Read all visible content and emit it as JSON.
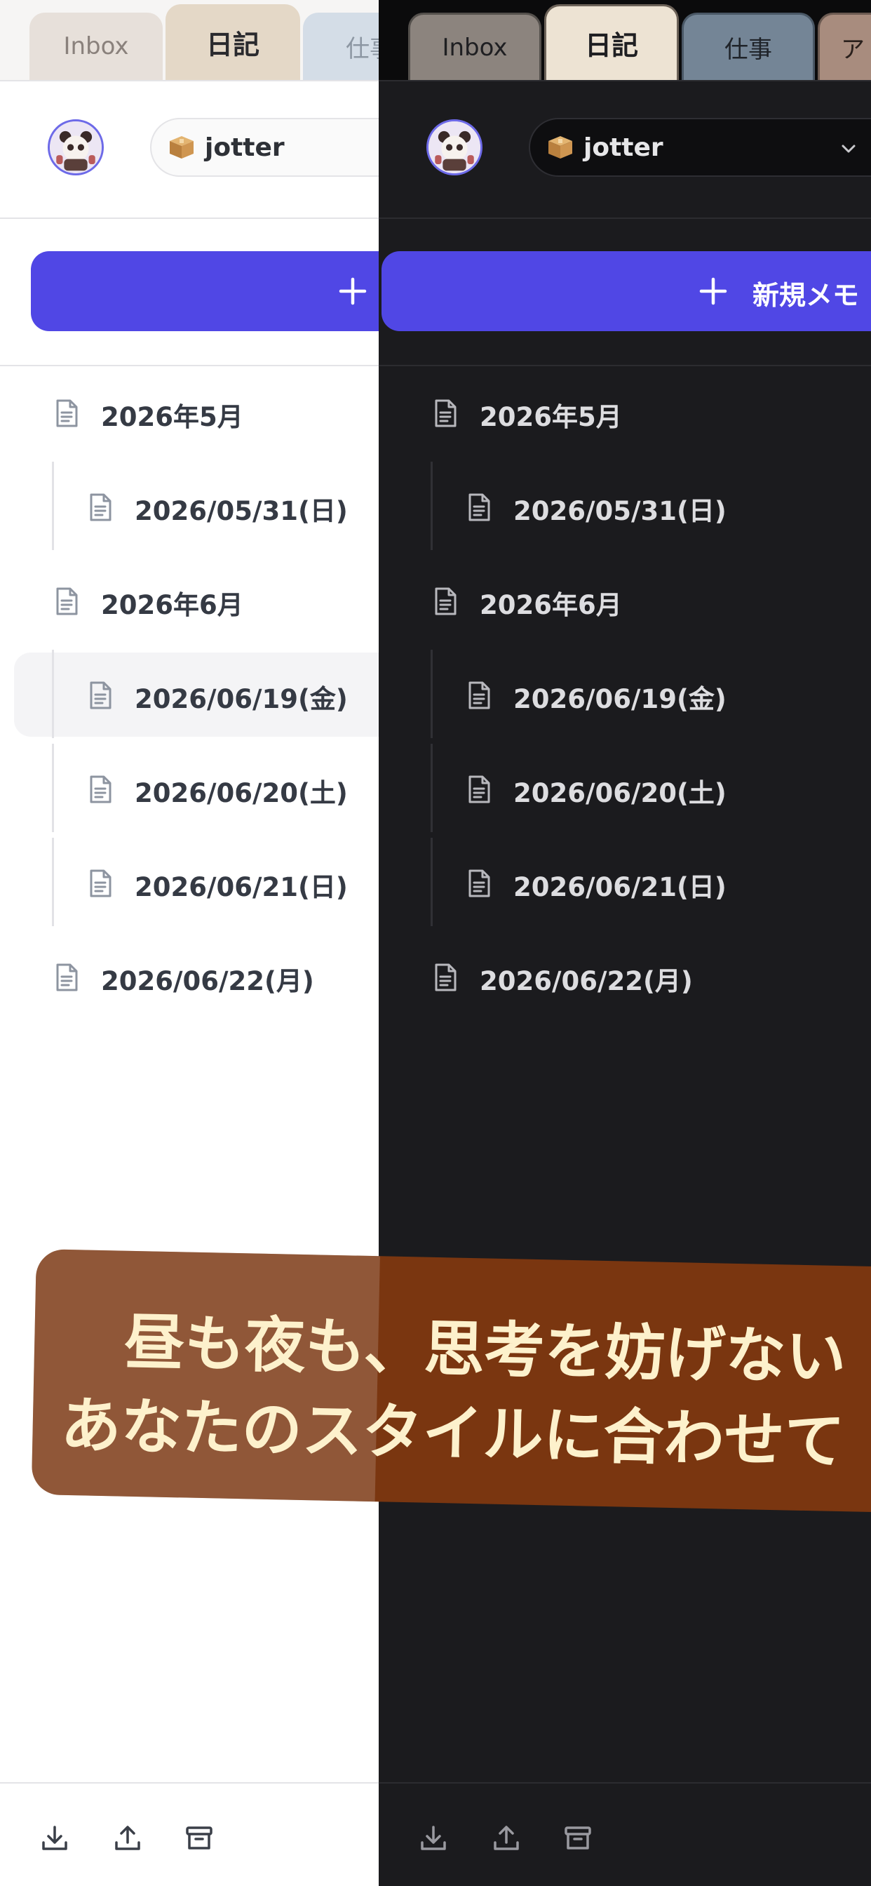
{
  "tabs": [
    "Inbox",
    "日記",
    "仕事",
    "ア"
  ],
  "active_tab": "日記",
  "notebook": {
    "label": "jotter",
    "icon": "package-icon"
  },
  "new_memo": {
    "label": "新規メモ"
  },
  "tree": [
    {
      "label": "2026年5月",
      "level": 0
    },
    {
      "label": "2026/05/31(日)",
      "level": 1
    },
    {
      "label": "2026年6月",
      "level": 0
    },
    {
      "label": "2026/06/19(金)",
      "level": 1,
      "selected_light": true
    },
    {
      "label": "2026/06/20(土)",
      "level": 1
    },
    {
      "label": "2026/06/21(日)",
      "level": 1
    },
    {
      "label": "2026/06/22(月)",
      "level": 0
    }
  ],
  "banner": {
    "line1": "昼も夜も、思考を妨げない",
    "line2": "あなたのスタイルに合わせて"
  },
  "footer_icons": [
    "download-icon",
    "upload-icon",
    "archive-icon"
  ],
  "colors": {
    "accent": "#5047e5",
    "banner": "#7a3610",
    "banner_text": "#fdf1cc",
    "dark_bg": "#1b1b1e"
  }
}
